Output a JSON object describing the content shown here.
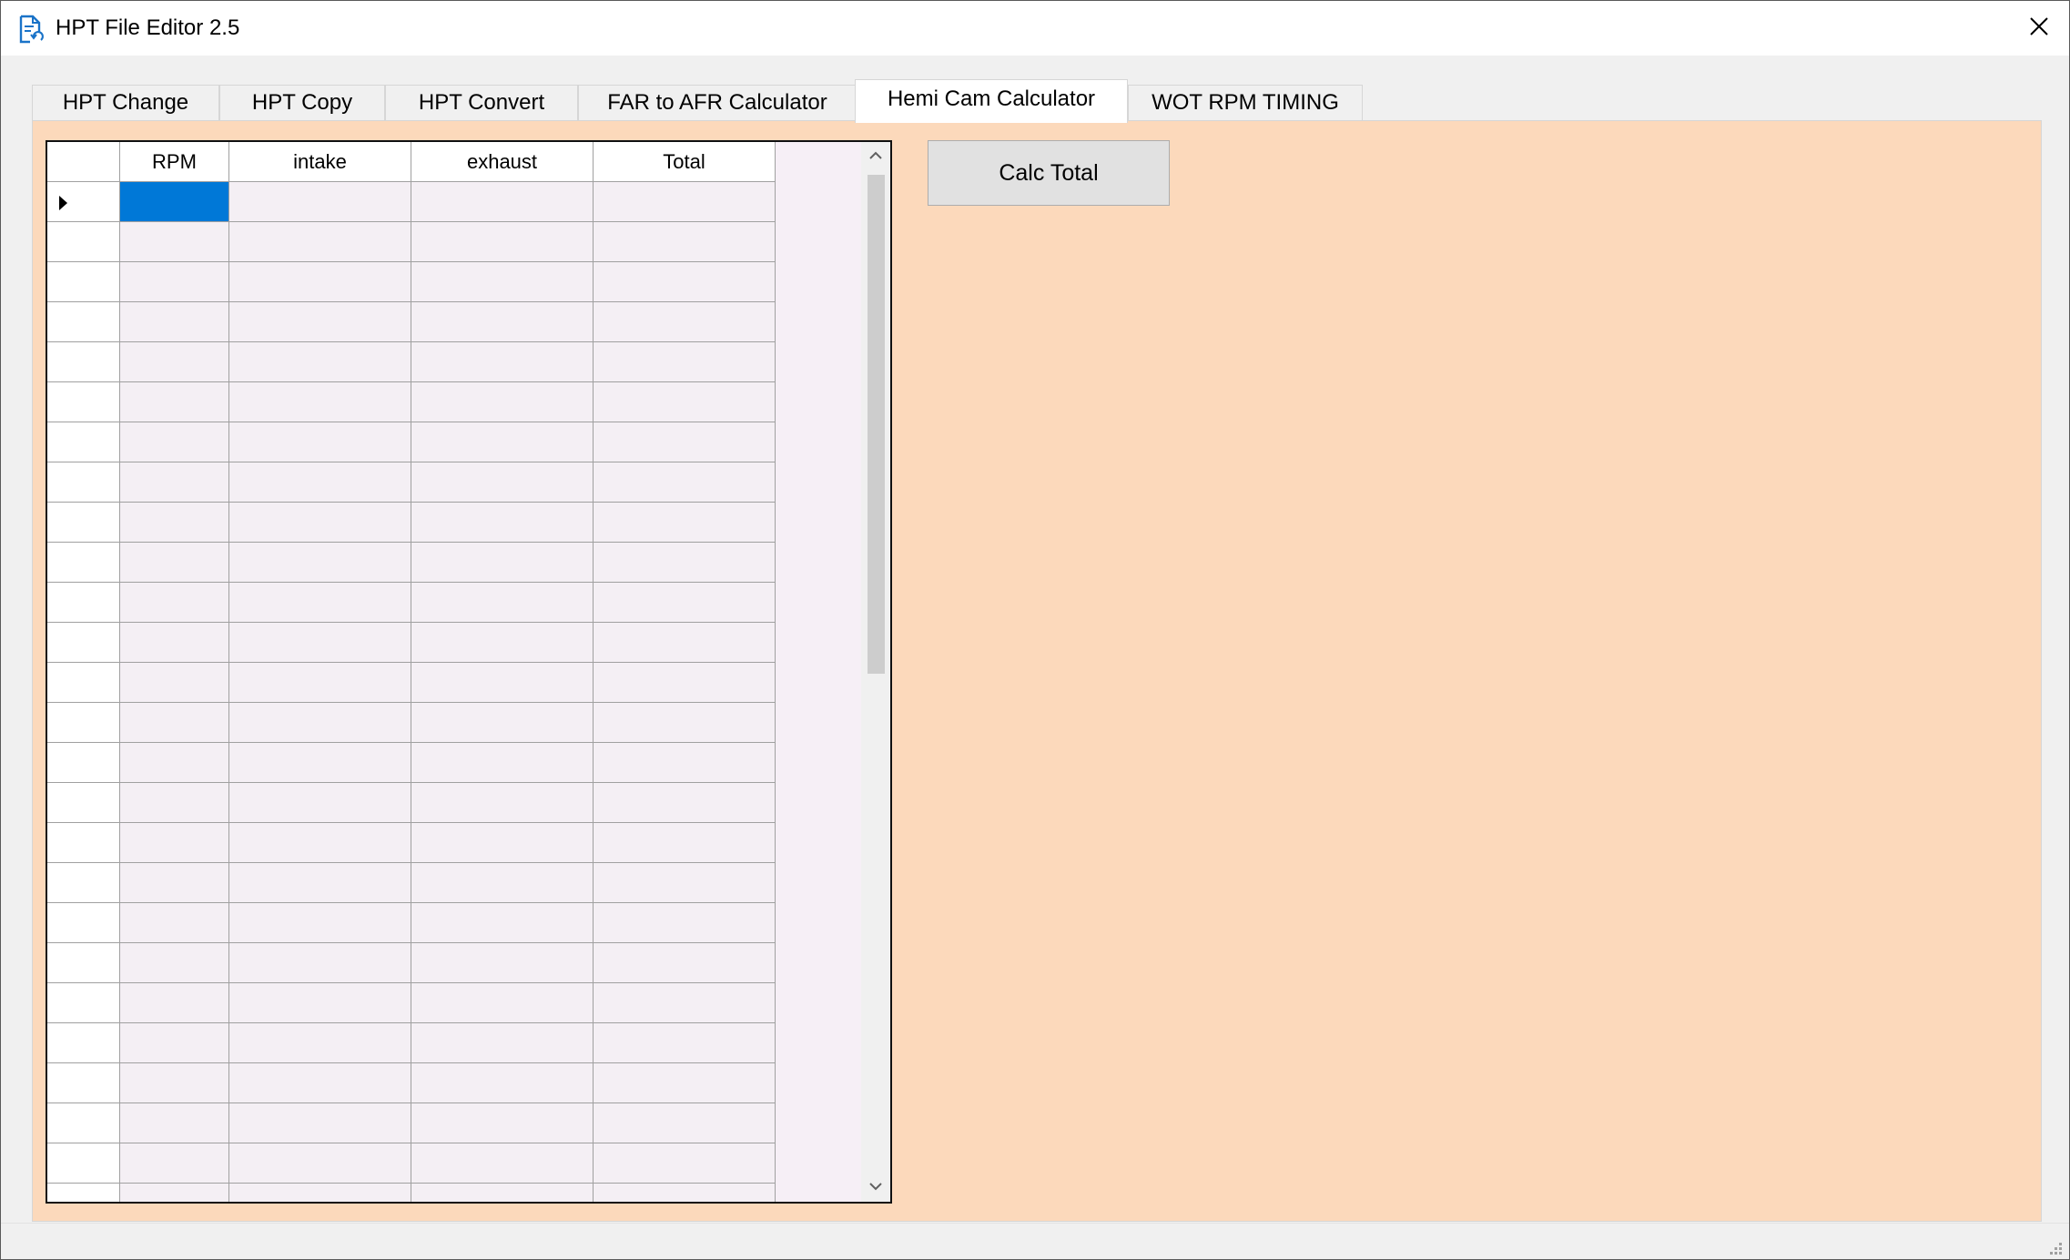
{
  "window": {
    "title": "HPT File Editor 2.5",
    "icon": "document-refresh-icon",
    "close_icon": "close-icon"
  },
  "tabs": [
    {
      "label": "HPT Change",
      "active": false
    },
    {
      "label": "HPT Copy",
      "active": false
    },
    {
      "label": "HPT Convert",
      "active": false
    },
    {
      "label": "FAR to AFR Calculator",
      "active": false
    },
    {
      "label": "Hemi Cam Calculator",
      "active": true
    },
    {
      "label": "WOT RPM TIMING",
      "active": false
    }
  ],
  "grid": {
    "columns": [
      "RPM",
      "intake",
      "exhaust",
      "Total"
    ],
    "rows": [
      [
        "",
        "",
        "",
        ""
      ],
      [
        "",
        "",
        "",
        ""
      ],
      [
        "",
        "",
        "",
        ""
      ],
      [
        "",
        "",
        "",
        ""
      ],
      [
        "",
        "",
        "",
        ""
      ],
      [
        "",
        "",
        "",
        ""
      ],
      [
        "",
        "",
        "",
        ""
      ],
      [
        "",
        "",
        "",
        ""
      ],
      [
        "",
        "",
        "",
        ""
      ],
      [
        "",
        "",
        "",
        ""
      ],
      [
        "",
        "",
        "",
        ""
      ],
      [
        "",
        "",
        "",
        ""
      ],
      [
        "",
        "",
        "",
        ""
      ],
      [
        "",
        "",
        "",
        ""
      ],
      [
        "",
        "",
        "",
        ""
      ],
      [
        "",
        "",
        "",
        ""
      ],
      [
        "",
        "",
        "",
        ""
      ],
      [
        "",
        "",
        "",
        ""
      ],
      [
        "",
        "",
        "",
        ""
      ],
      [
        "",
        "",
        "",
        ""
      ],
      [
        "",
        "",
        "",
        ""
      ],
      [
        "",
        "",
        "",
        ""
      ],
      [
        "",
        "",
        "",
        ""
      ],
      [
        "",
        "",
        "",
        ""
      ],
      [
        "",
        "",
        "",
        ""
      ],
      [
        "",
        "",
        "",
        ""
      ]
    ],
    "current_row_icon": "row-pointer-icon"
  },
  "buttons": {
    "calc_total": "Calc Total"
  },
  "colors": {
    "panel_background": "#fcd9bb",
    "selection": "#0078d7"
  }
}
